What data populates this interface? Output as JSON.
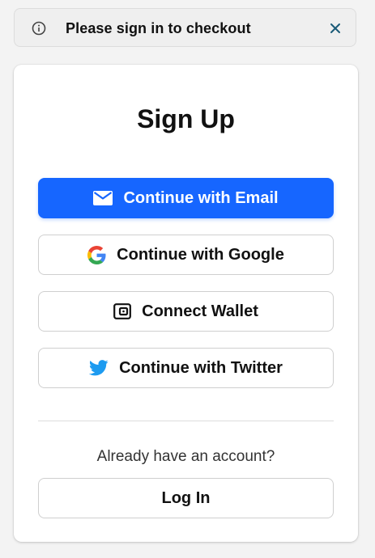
{
  "notice": {
    "text": "Please sign in to checkout",
    "info_icon": "info-icon",
    "close_icon": "close-icon"
  },
  "card": {
    "title": "Sign Up",
    "buttons": {
      "email": {
        "label": "Continue with Email",
        "icon": "mail-icon"
      },
      "google": {
        "label": "Continue with Google",
        "icon": "google-icon"
      },
      "wallet": {
        "label": "Connect Wallet",
        "icon": "wallet-icon"
      },
      "twitter": {
        "label": "Continue with Twitter",
        "icon": "twitter-icon"
      }
    },
    "already_text": "Already have an account?",
    "login_label": "Log In"
  },
  "colors": {
    "primary": "#1666ff",
    "notice_close": "#1a5a78",
    "twitter": "#1d9bf0"
  }
}
